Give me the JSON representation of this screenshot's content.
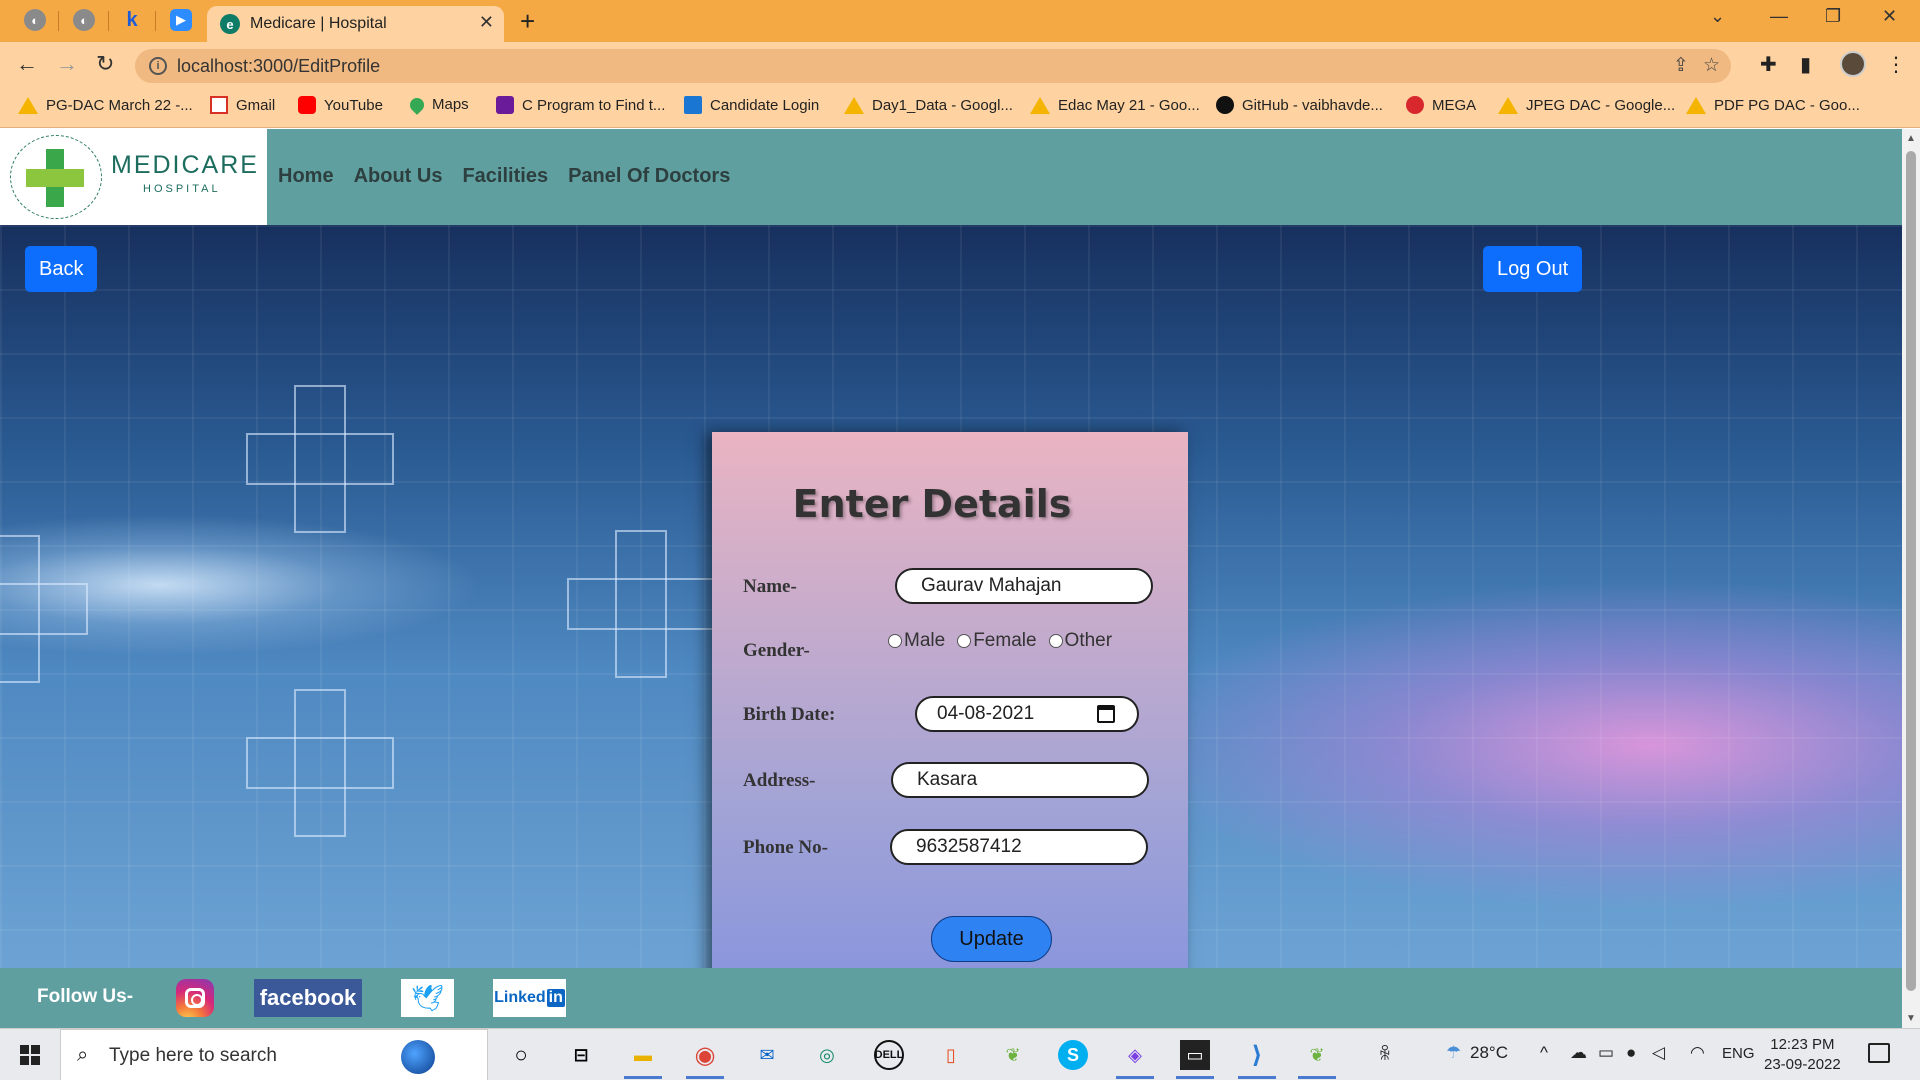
{
  "browser": {
    "active_tab_title": "Medicare | Hospital",
    "url": "localhost:3000/EditProfile",
    "bookmarks": [
      {
        "label": "PG-DAC March 22 -...",
        "icon": "drive-icon"
      },
      {
        "label": "Gmail",
        "icon": "gmail-icon"
      },
      {
        "label": "YouTube",
        "icon": "youtube-icon"
      },
      {
        "label": "Maps",
        "icon": "maps-icon"
      },
      {
        "label": "C Program to Find t...",
        "icon": "c-program-icon"
      },
      {
        "label": "Candidate Login",
        "icon": "candidate-icon"
      },
      {
        "label": "Day1_Data - Googl...",
        "icon": "drive-icon"
      },
      {
        "label": "Edac May 21 - Goo...",
        "icon": "drive-icon"
      },
      {
        "label": "GitHub - vaibhavde...",
        "icon": "github-icon"
      },
      {
        "label": "MEGA",
        "icon": "mega-icon"
      },
      {
        "label": "JPEG DAC - Google...",
        "icon": "drive-icon"
      },
      {
        "label": "PDF PG DAC - Goo...",
        "icon": "drive-icon"
      }
    ]
  },
  "site": {
    "logo_name": "MEDICARE",
    "logo_sub": "HOSPITAL",
    "nav": [
      "Home",
      "About Us",
      "Facilities",
      "Panel Of Doctors"
    ],
    "back_label": "Back",
    "logout_label": "Log Out"
  },
  "form": {
    "title": "Enter Details",
    "name_label": "Name-",
    "name_value": "Gaurav Mahajan",
    "gender_label": "Gender-",
    "gender_options": [
      "Male",
      "Female",
      "Other"
    ],
    "birth_label": "Birth Date:",
    "birth_value": "04-08-2021",
    "address_label": "Address-",
    "address_value": "Kasara",
    "phone_label": "Phone No-",
    "phone_value": "9632587412",
    "update_label": "Update"
  },
  "footer": {
    "follow_label": "Follow Us-",
    "facebook_label": "facebook",
    "linkedin_label": "Linked"
  },
  "taskbar": {
    "search_placeholder": "Type here to search",
    "weather": "28°C",
    "language": "ENG",
    "time": "12:23 PM",
    "date": "23-09-2022"
  }
}
